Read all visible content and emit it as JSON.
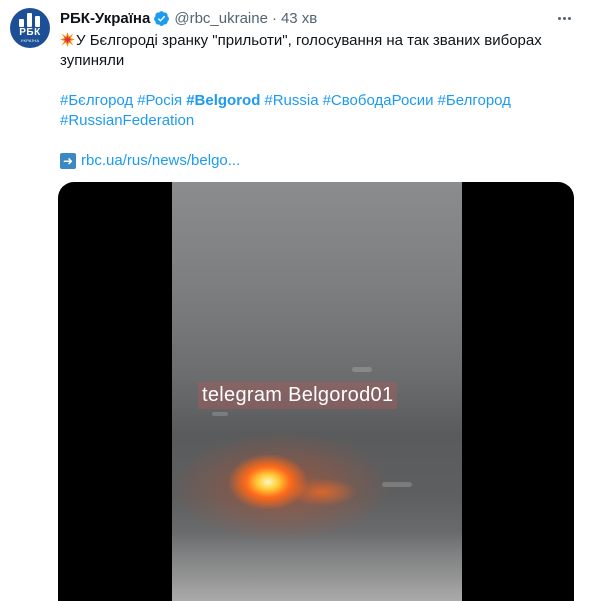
{
  "tweet": {
    "display_name": "РБК-Україна",
    "handle": "@rbc_ukraine",
    "separator": "·",
    "time": "43 хв",
    "text": "У Бєлгороді зранку \"прильоти\", голосування на так званих виборах зупиняли",
    "hashtags": [
      {
        "text": "#Бєлгород",
        "bold": false
      },
      {
        "text": "#Росія",
        "bold": false
      },
      {
        "text": "#Belgorod",
        "bold": true
      },
      {
        "text": "#Russia",
        "bold": false
      },
      {
        "text": "#СвободаРосии",
        "bold": false
      },
      {
        "text": "#Белгород",
        "bold": false
      },
      {
        "text": "#RussianFederation",
        "bold": false
      }
    ],
    "link": "rbc.ua/rus/news/belgo...",
    "avatar_logo": "РБК",
    "avatar_sub": "УКРАЇНА"
  },
  "media": {
    "watermark": "telegram Belgorod01"
  },
  "colors": {
    "link": "#1d9bf0",
    "secondary_text": "#536471",
    "primary_text": "#0f1419",
    "avatar_bg": "#1d4f97"
  },
  "icons": [
    "verified-badge-icon",
    "more-options-icon",
    "collision-emoji-icon",
    "right-arrow-emoji-icon"
  ]
}
